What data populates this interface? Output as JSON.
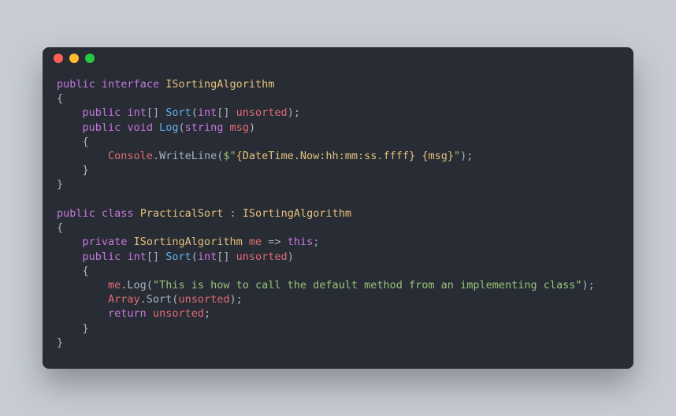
{
  "code": {
    "tokens": [
      [
        [
          "kw",
          "public"
        ],
        [
          "",
          ""
        ],
        [
          "kw",
          "interface"
        ],
        [
          "",
          ""
        ],
        [
          "type",
          "ISortingAlgorithm"
        ]
      ],
      [
        [
          "",
          "{"
        ]
      ],
      [
        [
          "",
          "    "
        ],
        [
          "kw",
          "public"
        ],
        [
          "",
          ""
        ],
        [
          "kw",
          "int"
        ],
        [
          "",
          "[] "
        ],
        [
          "fn",
          "Sort"
        ],
        [
          "",
          "("
        ],
        [
          "kw",
          "int"
        ],
        [
          "",
          "[] "
        ],
        [
          "var",
          "unsorted"
        ],
        [
          "",
          ");"
        ]
      ],
      [
        [
          "",
          "    "
        ],
        [
          "kw",
          "public"
        ],
        [
          "",
          ""
        ],
        [
          "kw",
          "void"
        ],
        [
          "",
          ""
        ],
        [
          "fn",
          "Log"
        ],
        [
          "",
          "("
        ],
        [
          "kw",
          "string"
        ],
        [
          "",
          ""
        ],
        [
          "var",
          "msg"
        ],
        [
          "",
          ")"
        ]
      ],
      [
        [
          "",
          "    {"
        ]
      ],
      [
        [
          "",
          "        "
        ],
        [
          "var",
          "Console"
        ],
        [
          "",
          ".WriteLine("
        ],
        [
          "str",
          "$\""
        ],
        [
          "strint",
          "{DateTime.Now:hh:mm:ss.ffff}"
        ],
        [
          "str",
          " "
        ],
        [
          "strint",
          "{msg}"
        ],
        [
          "str",
          "\""
        ],
        [
          "",
          ");"
        ]
      ],
      [
        [
          "",
          "    }"
        ]
      ],
      [
        [
          "",
          "}"
        ]
      ],
      [
        [
          "",
          ""
        ]
      ],
      [
        [
          "kw",
          "public"
        ],
        [
          "",
          ""
        ],
        [
          "kw",
          "class"
        ],
        [
          "",
          ""
        ],
        [
          "type",
          "PracticalSort"
        ],
        [
          "",
          ""
        ],
        [
          "",
          ":"
        ],
        [
          "",
          ""
        ],
        [
          "type",
          "ISortingAlgorithm"
        ]
      ],
      [
        [
          "",
          "{"
        ]
      ],
      [
        [
          "",
          "    "
        ],
        [
          "kw",
          "private"
        ],
        [
          "",
          ""
        ],
        [
          "type",
          "ISortingAlgorithm"
        ],
        [
          "",
          ""
        ],
        [
          "var",
          "me"
        ],
        [
          "",
          ""
        ],
        [
          "",
          "=>"
        ],
        [
          "",
          ""
        ],
        [
          "kw",
          "this"
        ],
        [
          "",
          ";"
        ]
      ],
      [
        [
          "",
          "    "
        ],
        [
          "kw",
          "public"
        ],
        [
          "",
          ""
        ],
        [
          "kw",
          "int"
        ],
        [
          "",
          "[] "
        ],
        [
          "fn",
          "Sort"
        ],
        [
          "",
          "("
        ],
        [
          "kw",
          "int"
        ],
        [
          "",
          "[] "
        ],
        [
          "var",
          "unsorted"
        ],
        [
          "",
          ")"
        ]
      ],
      [
        [
          "",
          "    {"
        ]
      ],
      [
        [
          "",
          "        "
        ],
        [
          "var",
          "me"
        ],
        [
          "",
          ".Log("
        ],
        [
          "str",
          "\"This is how to call the default method from an implementing class\""
        ],
        [
          "",
          ");"
        ]
      ],
      [
        [
          "",
          "        "
        ],
        [
          "var",
          "Array"
        ],
        [
          "",
          ".Sort("
        ],
        [
          "var",
          "unsorted"
        ],
        [
          "",
          ");"
        ]
      ],
      [
        [
          "",
          "        "
        ],
        [
          "kw",
          "return"
        ],
        [
          "",
          ""
        ],
        [
          "var",
          "unsorted"
        ],
        [
          "",
          ";"
        ]
      ],
      [
        [
          "",
          "    }"
        ]
      ],
      [
        [
          "",
          "}"
        ]
      ]
    ]
  },
  "colors": {
    "background": "#282c34",
    "page_background": "#c7ccd4",
    "traffic_red": "#ff5f56",
    "traffic_yellow": "#ffbd2e",
    "traffic_green": "#27c93f"
  }
}
